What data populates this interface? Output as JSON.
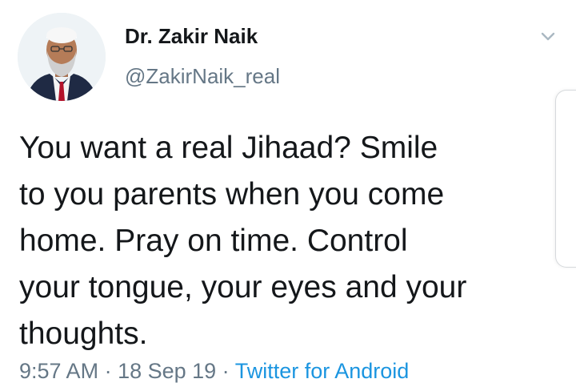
{
  "author": {
    "display_name": "Dr. Zakir Naik",
    "handle": "@ZakirNaik_real"
  },
  "tweet": {
    "lines": [
      "You want a real Jihaad? Smile",
      "to you parents when you come",
      "home. Pray on time. Control",
      "your tongue, your eyes and your",
      "thoughts."
    ],
    "time": "9:57 AM",
    "separator1": " · ",
    "date": "18 Sep 19",
    "separator2": " · ",
    "source": "Twitter for Android"
  },
  "icons": {
    "menu": "chevron-down-icon"
  },
  "colors": {
    "text": "#14171a",
    "secondary": "#657786",
    "link": "#1b95e0"
  }
}
